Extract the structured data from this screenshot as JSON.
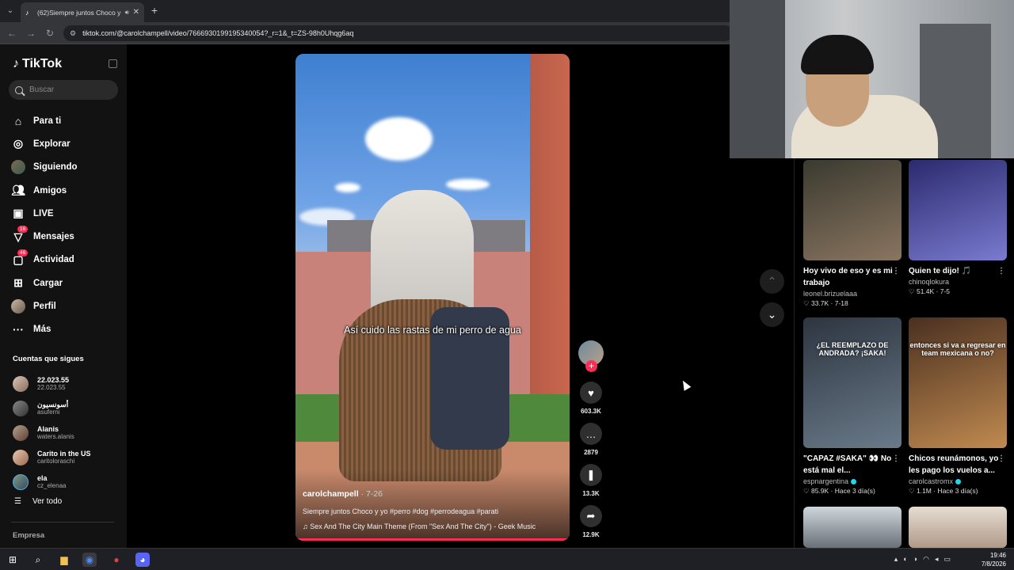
{
  "browser": {
    "tab_title": "(62)Siempre juntos Choco y",
    "url": "tiktok.com/@carolchampell/video/7666930199195340054?_r=1&_t=ZS-98h0Uhqg6aq"
  },
  "sidebar": {
    "brand": "TikTok",
    "search_placeholder": "Buscar",
    "items": [
      {
        "label": "Para ti",
        "icon": "home-icon"
      },
      {
        "label": "Explorar",
        "icon": "compass-icon"
      },
      {
        "label": "Siguiendo",
        "icon": "avatar-icon"
      },
      {
        "label": "Amigos",
        "icon": "friends-icon"
      },
      {
        "label": "LIVE",
        "icon": "live-icon"
      },
      {
        "label": "Mensajes",
        "icon": "messages-icon",
        "badge": "16"
      },
      {
        "label": "Actividad",
        "icon": "activity-icon",
        "badge": "46"
      },
      {
        "label": "Cargar",
        "icon": "upload-icon"
      },
      {
        "label": "Perfil",
        "icon": "profile-icon"
      },
      {
        "label": "Más",
        "icon": "more-icon"
      }
    ],
    "following_title": "Cuentas que sigues",
    "accounts": [
      {
        "name": "22.023.55",
        "handle": "22.023.55"
      },
      {
        "name": "أسونسيون",
        "handle": "asuferni"
      },
      {
        "name": "Alanis",
        "handle": "waters.alanis"
      },
      {
        "name": "Carito in the US",
        "handle": "caritoloraschi"
      },
      {
        "name": "ela",
        "handle": "cz_elenaa"
      }
    ],
    "see_all": "Ver todo",
    "company": "Empresa"
  },
  "video": {
    "overlay_caption": "Así cuido las rastas de mi perro de agua",
    "author": "carolchampell",
    "date": " · 7-26",
    "description": "Siempre juntos Choco y yo #perro #dog #perrodeagua #parati",
    "music": "♫  Sex And The City Main Theme (From \"Sex And The City\") - Geek Music",
    "progress": 1.0
  },
  "actions": {
    "likes": "603.3K",
    "comments": "2879",
    "saves": "13.3K",
    "shares": "12.9K"
  },
  "recommended": [
    {
      "title": "Hoy vivo de eso y es mi trabajo",
      "author": "leonel.brizuelaaa",
      "verified": false,
      "stats": "♡ 33.7K · 7-18",
      "overlay": "",
      "color1": "#3a3a30",
      "color2": "#8a7560"
    },
    {
      "title": "Quien te dijo! 🎵",
      "author": "chinoqlokura",
      "verified": false,
      "stats": "♡ 51.4K · 7-5",
      "overlay": "",
      "color1": "#2b2a6e",
      "color2": "#7a7ad0"
    },
    {
      "title": "\"CAPAZ #SAKA\" 👀 No está mal el...",
      "author": "espnargentina",
      "verified": true,
      "stats": "♡ 85.9K · Hace 3 día(s)",
      "overlay": "¿EL REEMPLAZO DE ANDRADA? ¡SAKA!",
      "color1": "#2d3540",
      "color2": "#6a7a8a"
    },
    {
      "title": "Chicos reunámonos, yo les pago los vuelos a...",
      "author": "carolcastromx",
      "verified": true,
      "stats": "♡ 1.1M · Hace 3 día(s)",
      "overlay": "entonces si va a regresar en team mexicana o no?",
      "color1": "#4a3020",
      "color2": "#c08a50"
    }
  ],
  "taskbar": {
    "time": "19:46",
    "date": "7/8/2026"
  }
}
